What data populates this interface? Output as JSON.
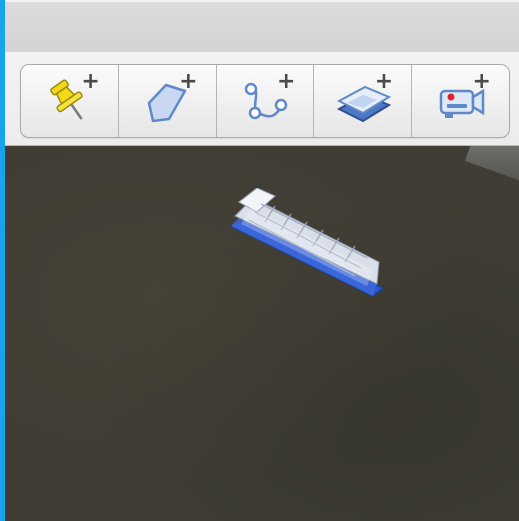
{
  "window": {
    "title": ""
  },
  "toolbar": {
    "buttons": [
      {
        "id": "add-placemark",
        "icon": "pushpin-icon",
        "badge": "+"
      },
      {
        "id": "add-polygon",
        "icon": "polygon-icon",
        "badge": "+"
      },
      {
        "id": "add-path",
        "icon": "path-icon",
        "badge": "+"
      },
      {
        "id": "add-image-overlay",
        "icon": "image-overlay-icon",
        "badge": "+"
      },
      {
        "id": "record-tour",
        "icon": "video-camera-icon",
        "badge": "+"
      }
    ]
  },
  "colors": {
    "accent_edge": "#1aa3ec",
    "pin_yellow": "#f2d91a",
    "icon_blue": "#5f89c8",
    "record_red": "#e0202a",
    "water": "#3f3d34",
    "ship_hull": "#2f56c8"
  },
  "map": {
    "feature": "ship-3d-model"
  }
}
